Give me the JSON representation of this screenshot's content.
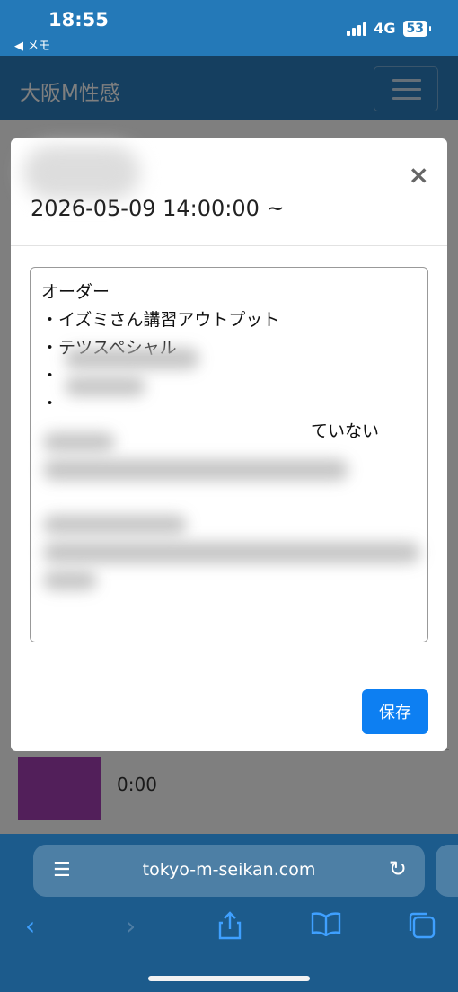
{
  "status": {
    "time": "18:55",
    "back_label": "◀ メモ",
    "network": "4G",
    "battery": "53"
  },
  "navbar": {
    "brand": "大阪M性感"
  },
  "modal": {
    "title": "2026-05-09 14:00:00 ~",
    "close_label": "×",
    "memo_lines": [
      "オーダー",
      "・イズミさん講習アウトプット",
      "・テツスペシャル",
      "・",
      "・",
      "",
      "",
      "ていない",
      "",
      ""
    ],
    "save_label": "保存"
  },
  "page": {
    "row_time": "0:00",
    "row_price": "¥"
  },
  "safari": {
    "url": "tokyo-m-seikan.com"
  },
  "icons": {
    "tabs": "page-menu-icon",
    "reload": "reload-icon",
    "back": "back-icon",
    "forward": "forward-icon",
    "share": "share-icon",
    "bookmarks": "bookmarks-icon",
    "tabs_overview": "tabs-icon"
  }
}
